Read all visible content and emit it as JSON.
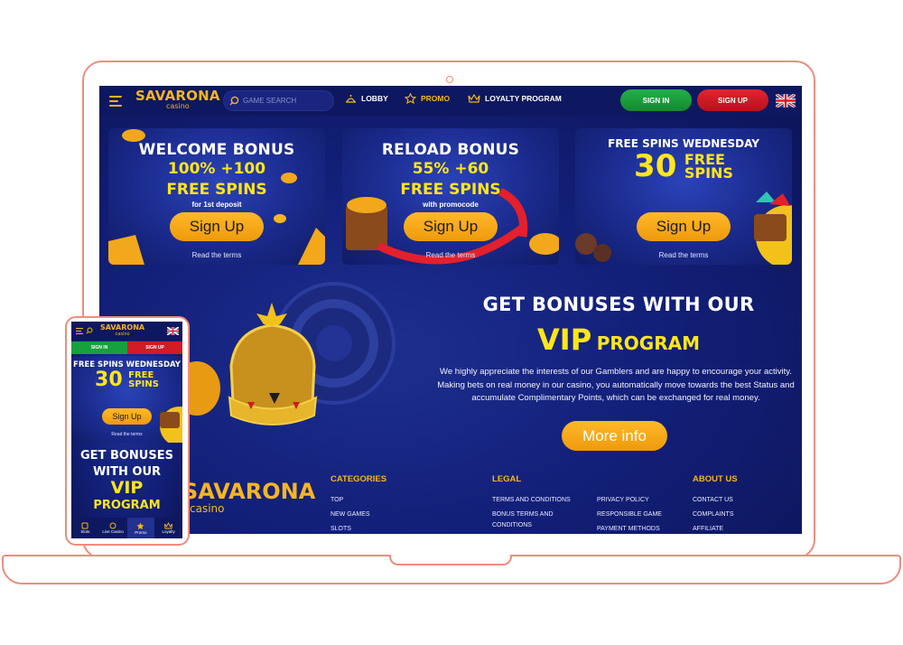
{
  "site": {
    "logo_main": "SAVARONA",
    "logo_sub": "casino"
  },
  "header": {
    "search_placeholder": "GAME SEARCH",
    "nav": [
      {
        "label": "LOBBY",
        "icon": "lobby-icon",
        "active": false
      },
      {
        "label": "PROMO",
        "icon": "star-icon",
        "active": true
      },
      {
        "label": "LOYALTY PROGRAM",
        "icon": "crown-icon",
        "active": false
      }
    ],
    "signin_label": "SIGN IN",
    "signup_label": "SIGN UP",
    "language_icon": "uk-flag-icon"
  },
  "promos": [
    {
      "title": "WELCOME BONUS",
      "line1": "100% +100",
      "line2": "FREE SPINS",
      "note": "for 1st deposit",
      "button": "Sign Up",
      "terms": "Read the terms"
    },
    {
      "title": "RELOAD BONUS",
      "line1": "55% +60",
      "line2": "FREE SPINS",
      "note": "with promocode",
      "button": "Sign Up",
      "terms": "Read the terms"
    },
    {
      "title": "FREE SPINS WEDNESDAY",
      "number": "30",
      "word1": "FREE",
      "word2": "SPINS",
      "button": "Sign Up",
      "terms": "Read the terms"
    }
  ],
  "vip": {
    "title_line1": "GET BONUSES WITH OUR",
    "title_vip": "VIP",
    "title_program": "PROGRAM",
    "text": "We highly appreciate the interests of our Gamblers and are happy to encourage your activity. Making bets on real money in our casino, you automatically move towards the best Status and accumulate Complimentary Points, which can be exchanged for real money.",
    "button": "More info"
  },
  "footer": {
    "logo_main": "SAVARONA",
    "logo_sub": "casino",
    "categories": {
      "heading": "CATEGORIES",
      "links": [
        "TOP",
        "NEW GAMES",
        "SLOTS"
      ]
    },
    "legal": {
      "heading": "LEGAL",
      "col1": [
        "TERMS AND CONDITIONS",
        "BONUS TERMS AND",
        "CONDITIONS"
      ],
      "col2": [
        "PRIVACY POLICY",
        "RESPONSIBLE GAME",
        "PAYMENT METHODS"
      ]
    },
    "about": {
      "heading": "ABOUT US",
      "links": [
        "CONTACT US",
        "COMPLAINTS",
        "AFFILIATE"
      ]
    }
  },
  "mobile": {
    "logo_main": "SAVARONA",
    "logo_sub": "casino",
    "signin_label": "SIGN IN",
    "signup_label": "SIGN UP",
    "promo_title": "FREE SPINS WEDNESDAY",
    "promo_number": "30",
    "promo_word1": "FREE",
    "promo_word2": "SPINS",
    "promo_button": "Sign Up",
    "promo_terms": "Read the terms",
    "vip_line1": "GET BONUSES",
    "vip_line2": "WITH OUR",
    "vip_line3": "VIP",
    "vip_line4": "PROGRAM",
    "tabs": [
      {
        "label": "Slots",
        "icon": "slot-icon"
      },
      {
        "label": "Live Casino",
        "icon": "chip-icon"
      },
      {
        "label": "Promo",
        "icon": "star-icon"
      },
      {
        "label": "Loyalty",
        "icon": "crown-icon"
      }
    ]
  },
  "colors": {
    "accent_gold": "#f6b521",
    "bright_yellow": "#ffe61b",
    "signin_green": "#22b04a",
    "signup_red": "#e32530",
    "background_navy": "#13207a",
    "frame_coral": "#f08c7e"
  }
}
